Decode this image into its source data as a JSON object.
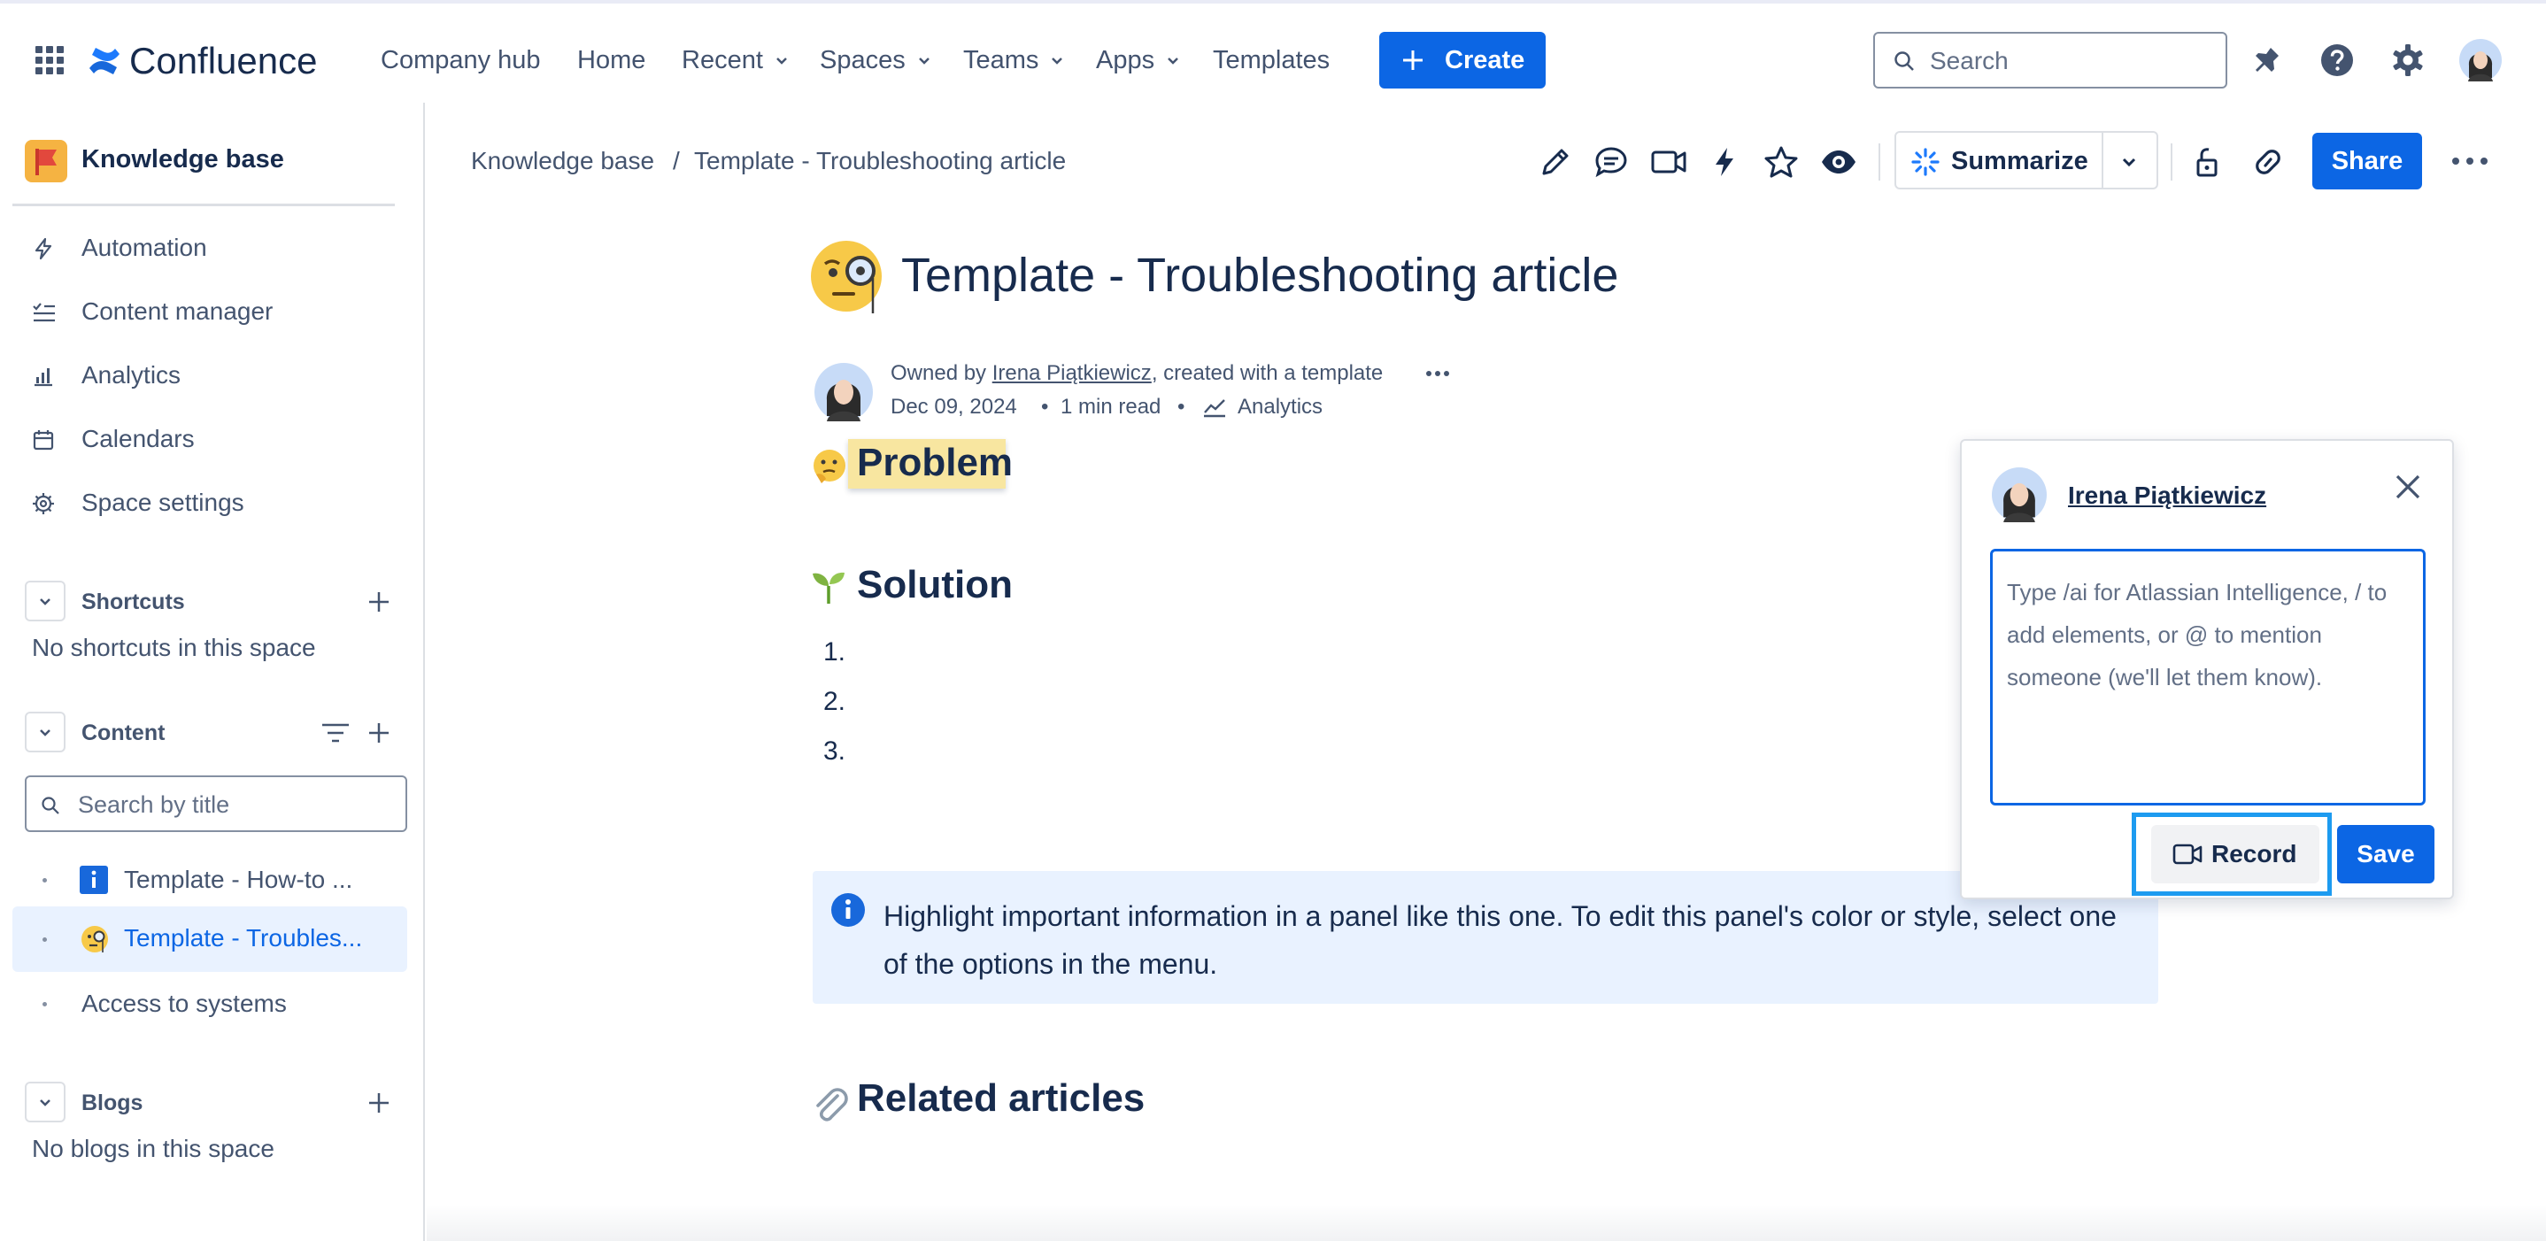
{
  "colors": {
    "brand": "#0c66e4",
    "text": "#172b4d",
    "subtle": "#44546f",
    "panel": "#e9f2ff",
    "highlight": "#1d9bf0"
  },
  "topnav": {
    "app_name": "Confluence",
    "items": [
      "Company hub",
      "Home",
      "Recent",
      "Spaces",
      "Teams",
      "Apps",
      "Templates"
    ],
    "create_label": "Create",
    "search_placeholder": "Search"
  },
  "sidebar": {
    "space_name": "Knowledge base",
    "nav": [
      "Automation",
      "Content manager",
      "Analytics",
      "Calendars",
      "Space settings"
    ],
    "shortcuts": {
      "title": "Shortcuts",
      "empty": "No shortcuts in this space"
    },
    "content": {
      "title": "Content",
      "search_placeholder": "Search by title",
      "pages": [
        "Template - How-to ...",
        "Template - Troubles...",
        "Access to systems"
      ]
    },
    "blogs": {
      "title": "Blogs",
      "empty": "No blogs in this space"
    }
  },
  "breadcrumb": {
    "space": "Knowledge base",
    "separator": "/",
    "page": "Template - Troubleshooting article"
  },
  "toolbar": {
    "summarize_label": "Summarize",
    "share_label": "Share"
  },
  "page": {
    "title": "Template - Troubleshooting article",
    "owned_by_prefix": "Owned by",
    "owner": "Irena Piątkiewicz",
    "owned_by_suffix": ", created with a template",
    "date": "Dec 09, 2024",
    "read_time": "1 min read",
    "analytics_label": "Analytics",
    "problem_heading": "Problem",
    "solution_heading": "Solution",
    "list_numbers": [
      "1.",
      "2.",
      "3."
    ],
    "panel_text": "Highlight important information in a panel like this one. To edit this panel's color or style, select one of the options in the menu.",
    "related_heading": "Related articles"
  },
  "comment": {
    "author": "Irena Piątkiewicz",
    "placeholder": "Type /ai for Atlassian Intelligence, / to add elements, or @ to mention someone (we'll let them know).",
    "record_label": "Record",
    "save_label": "Save"
  }
}
